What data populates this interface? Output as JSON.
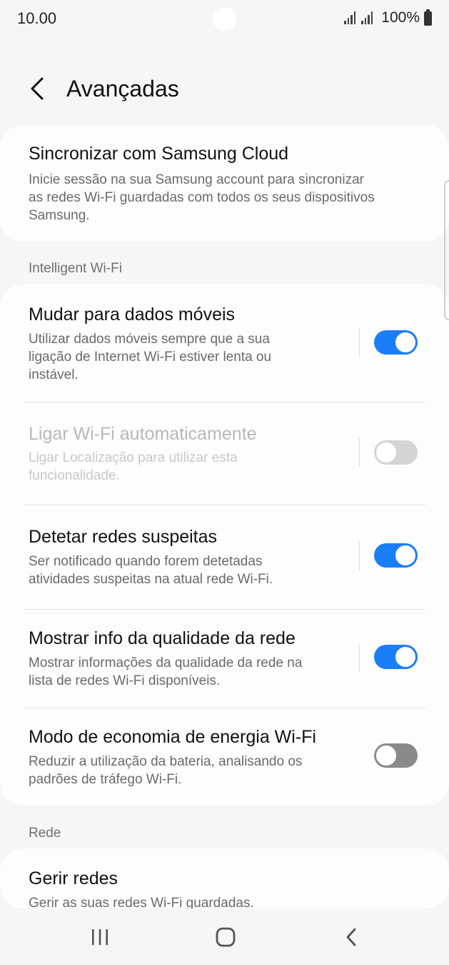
{
  "status_bar": {
    "time": "10.00",
    "battery": "100%",
    "icons": [
      "signal-icon",
      "signal-icon",
      "battery-icon"
    ]
  },
  "header": {
    "title": "Avançadas",
    "back_icon": "chevron-left-icon"
  },
  "sync": {
    "title": "Sincronizar com Samsung Cloud",
    "desc_lines": [
      "Inicie sessão na sua Samsung account para sincronizar",
      "as redes Wi-Fi guardadas com todos os seus dispositivos",
      "Samsung."
    ]
  },
  "intelligent_wifi": {
    "header": "Intelligent Wi-Fi",
    "items": [
      {
        "title": "Mudar para dados móveis",
        "desc_lines": [
          "Utilizar dados móveis sempre que a sua",
          "ligação de Internet Wi-Fi estiver lenta ou",
          "instável."
        ],
        "toggle": "on",
        "enabled": true
      },
      {
        "title": "Ligar Wi-Fi automaticamente",
        "desc_lines": [
          "Ligar Localização para utilizar esta",
          "funcionalidade."
        ],
        "toggle": "off",
        "enabled": false
      },
      {
        "title": "Detetar redes suspeitas",
        "desc_lines": [
          "Ser notificado quando forem detetadas",
          "atividades suspeitas na atual rede Wi-Fi."
        ],
        "toggle": "on",
        "enabled": true
      },
      {
        "title": "Mostrar info da qualidade da rede",
        "desc_lines": [
          "Mostrar informações da qualidade da rede na",
          "lista de redes Wi-Fi disponíveis."
        ],
        "toggle": "on",
        "enabled": true
      },
      {
        "title": "Modo de economia de energia Wi-Fi",
        "desc_lines": [
          "Reduzir a utilização da bateria, analisando os",
          "padrões de tráfego Wi-Fi."
        ],
        "toggle": "off",
        "enabled": true
      }
    ]
  },
  "rede": {
    "header": "Rede",
    "items": [
      {
        "title": "Gerir redes",
        "desc_lines": [
          "Gerir as suas redes Wi-Fi guardadas."
        ]
      }
    ]
  },
  "nav_bar": {
    "buttons": [
      "recents-icon",
      "home-icon",
      "back-icon"
    ]
  },
  "colors": {
    "accent": "#1a7ef6",
    "background": "#f6f6f6",
    "card": "#fdfdfd"
  }
}
